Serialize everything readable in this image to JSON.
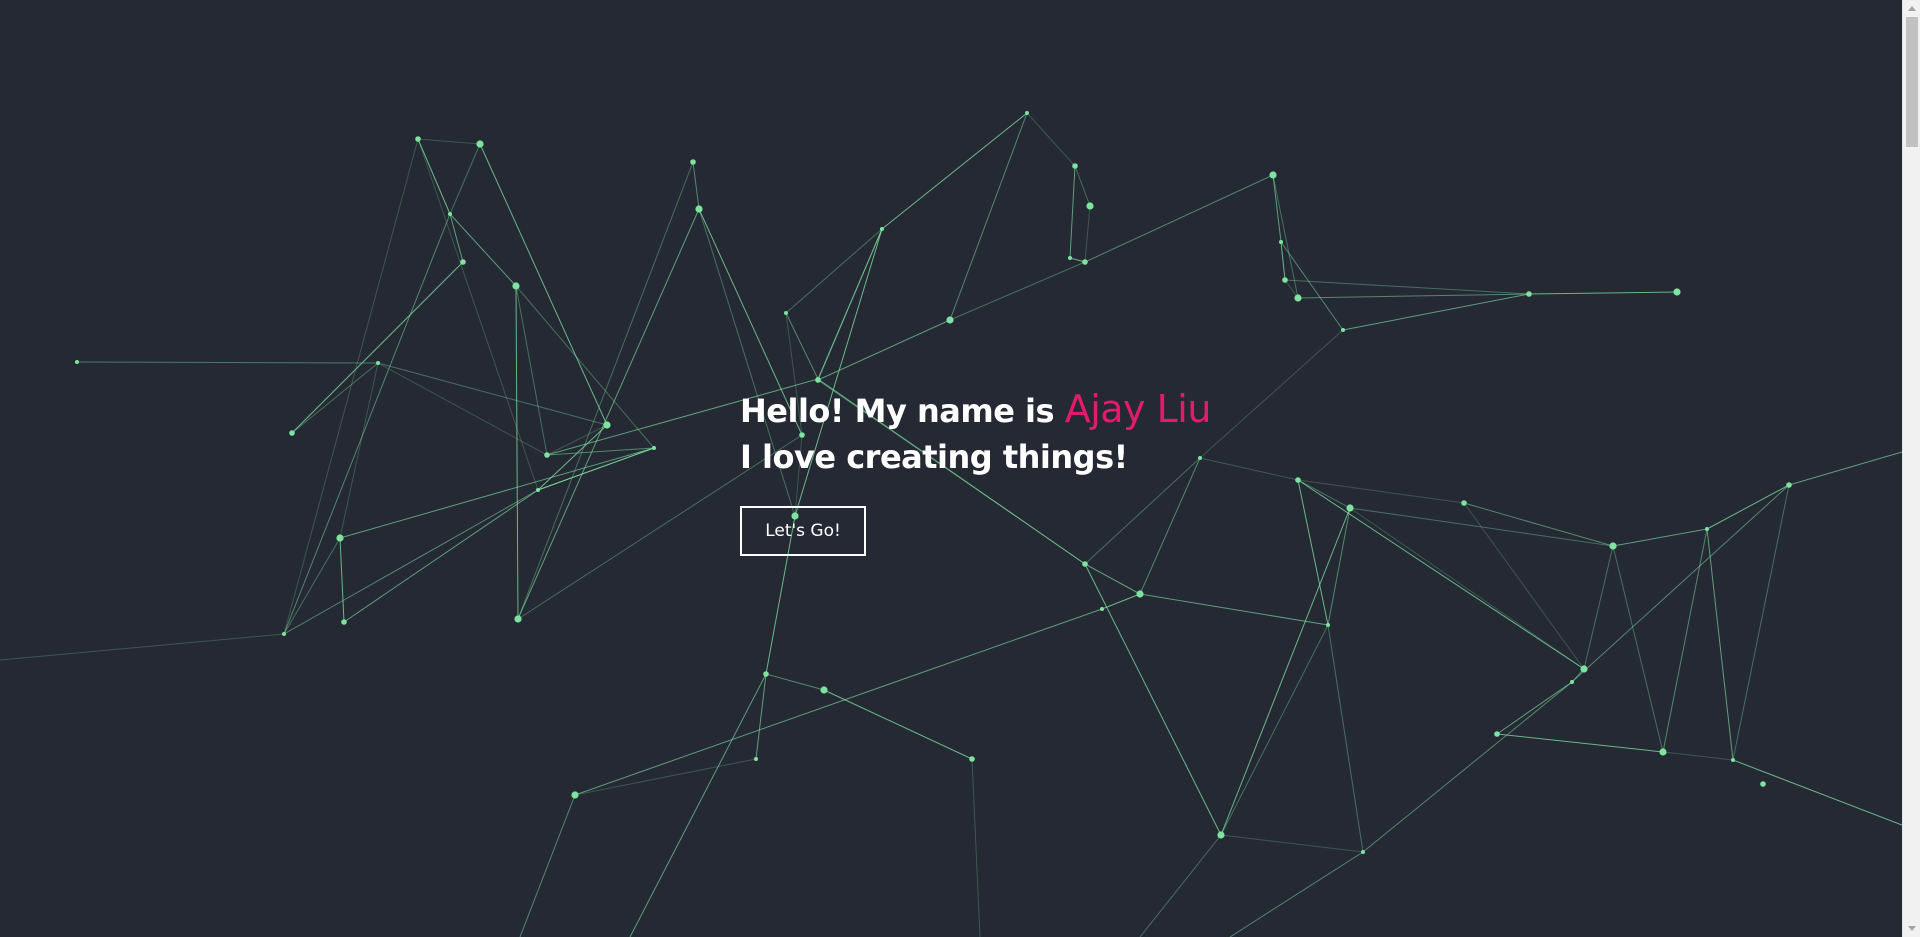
{
  "hero": {
    "greeting": "Hello! My name is ",
    "name": "Ajay Liu",
    "tagline": "I love creating things!"
  },
  "cta": {
    "label": "Let's Go!"
  },
  "colors": {
    "background": "#252934",
    "accent": "#e31b6d",
    "network": "#7fe3a0",
    "text": "#ffffff"
  }
}
